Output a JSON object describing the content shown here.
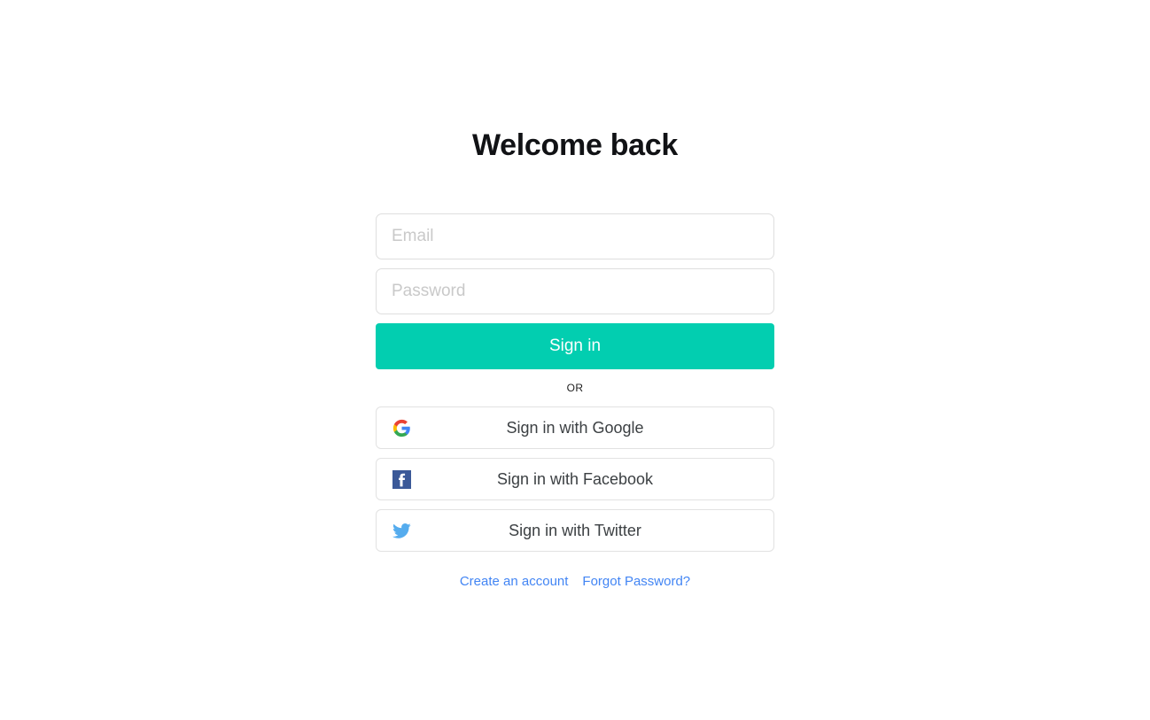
{
  "theme": {
    "background": "#ffffff",
    "primary_color": "#02CEB0",
    "link_color": "#4285F4",
    "text_color": "#3c4043",
    "title_color": "#111215",
    "placeholder_color": "#c9c9c9",
    "border_color": "#dedede"
  },
  "auth": {
    "title": "Welcome back",
    "email": {
      "placeholder": "Email",
      "value": ""
    },
    "password": {
      "placeholder": "Password",
      "value": ""
    },
    "submit_label": "Sign in",
    "divider_label": "OR",
    "social_buttons": [
      {
        "label": "Sign in with Google",
        "icon": "google-icon",
        "provider": "google"
      },
      {
        "label": "Sign in with Facebook",
        "icon": "facebook-icon",
        "provider": "facebook"
      },
      {
        "label": "Sign in with Twitter",
        "icon": "twitter-icon",
        "provider": "twitter"
      }
    ],
    "links": [
      {
        "label": "Create an account",
        "name": "create-account-link"
      },
      {
        "label": "Forgot Password?",
        "name": "forgot-password-link"
      }
    ]
  }
}
